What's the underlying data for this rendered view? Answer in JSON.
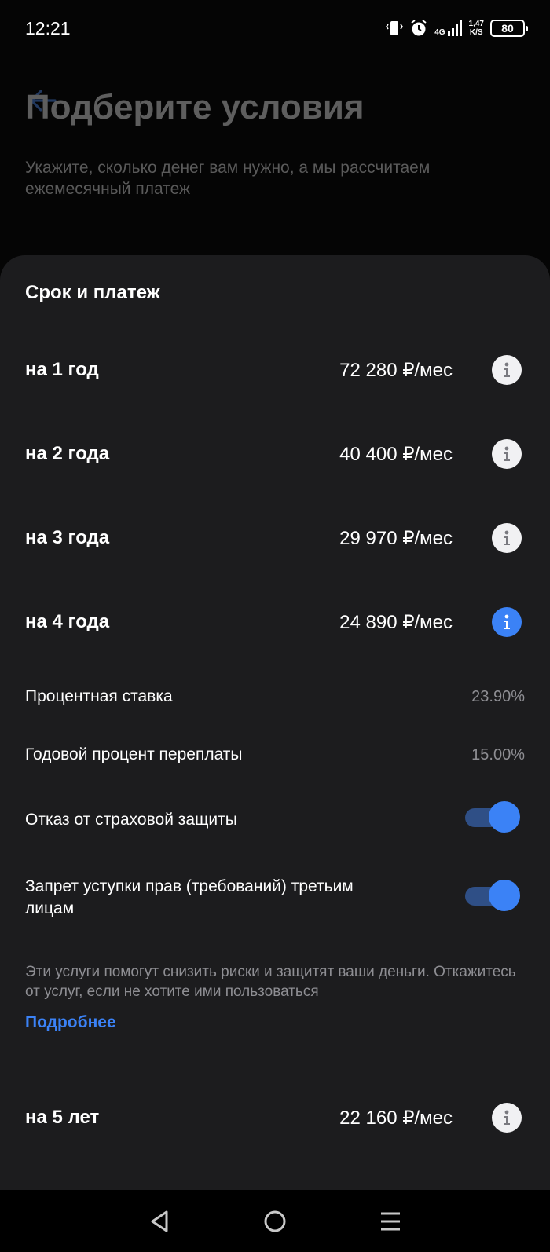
{
  "status_bar": {
    "time": "12:21",
    "network": "4G",
    "speed_value": "1,47",
    "speed_unit": "K/S",
    "battery": "80"
  },
  "header": {
    "title": "Подберите условия",
    "subtitle": "Укажите, сколько денег вам нужно, а мы рассчитаем ежемесячный платеж"
  },
  "sheet": {
    "title": "Срок и платеж",
    "terms": [
      {
        "label": "на 1 год",
        "price": "72 280 ₽/мес",
        "active": false
      },
      {
        "label": "на 2 года",
        "price": "40 400 ₽/мес",
        "active": false
      },
      {
        "label": "на 3 года",
        "price": "29 970 ₽/мес",
        "active": false
      },
      {
        "label": "на 4 года",
        "price": "24 890 ₽/мес",
        "active": true
      },
      {
        "label": "на 5 лет",
        "price": "22 160 ₽/мес",
        "active": false
      }
    ],
    "interest_rate": {
      "label": "Процентная ставка",
      "value": "23.90%"
    },
    "annual_overpayment": {
      "label": "Годовой процент переплаты",
      "value": "15.00%"
    },
    "insurance_refusal": {
      "label": "Отказ от страховой защиты",
      "on": true
    },
    "assignment_ban": {
      "label": "Запрет уступки прав (требований) третьим лицам",
      "on": true
    },
    "services_note": "Эти услуги помогут снизить риски и защитят ваши деньги. Откажитесь от услуг, если не хотите ими пользоваться",
    "more_link": "Подробнее"
  },
  "colors": {
    "accent": "#3b82f6",
    "sheet_bg": "#1c1c1e",
    "muted_text": "#8e8e93"
  },
  "icons": [
    "back-arrow-icon",
    "info-icon",
    "vibrate-icon",
    "alarm-icon",
    "signal-icon",
    "nav-back-icon",
    "nav-home-icon",
    "nav-menu-icon"
  ]
}
